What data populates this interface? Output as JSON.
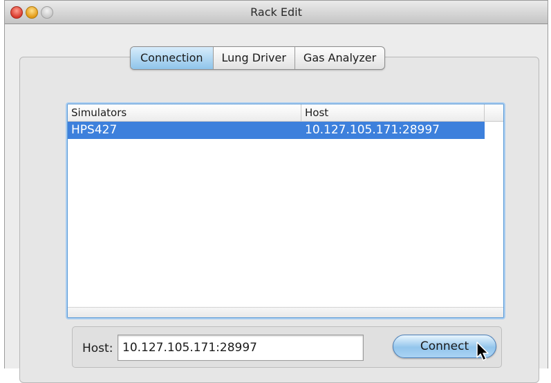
{
  "window": {
    "title": "Rack Edit"
  },
  "tabs": [
    {
      "label": "Connection",
      "selected": true
    },
    {
      "label": "Lung Driver",
      "selected": false
    },
    {
      "label": "Gas Analyzer",
      "selected": false
    }
  ],
  "table": {
    "columns": [
      "Simulators",
      "Host"
    ],
    "rows": [
      {
        "simulator": "HPS427",
        "host": "10.127.105.171:28997",
        "selected": true
      }
    ]
  },
  "footer": {
    "host_label": "Host:",
    "host_value": "10.127.105.171:28997",
    "connect_label": "Connect"
  },
  "colors": {
    "selection": "#3d80dc",
    "tab_selected": "#8fc4ea",
    "button_accent": "#93c5ec"
  },
  "icons": [
    "close-icon",
    "minimize-icon",
    "zoom-icon",
    "mouse-cursor-icon"
  ]
}
